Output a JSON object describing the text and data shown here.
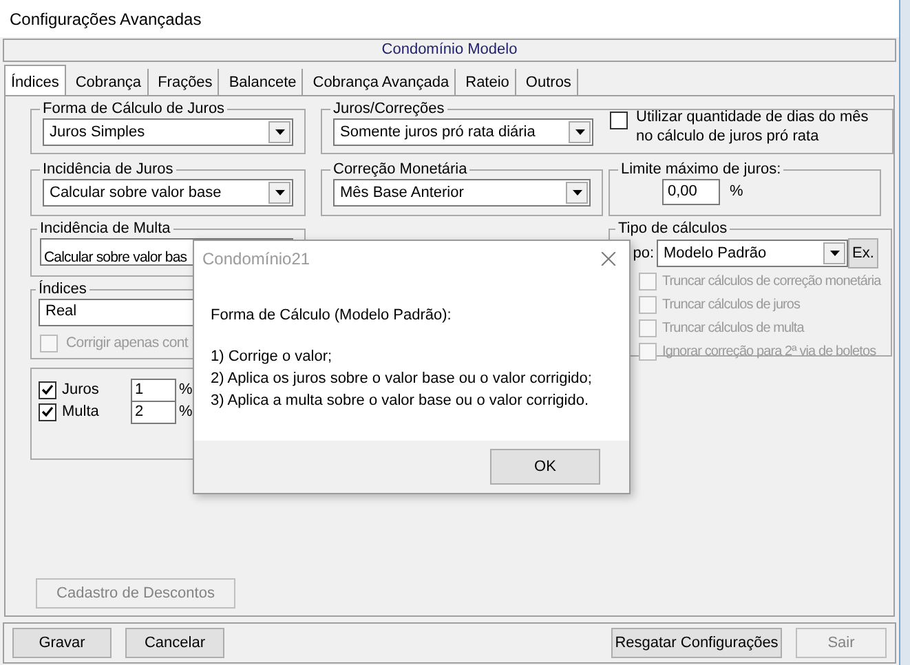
{
  "window": {
    "title": "Configurações Avançadas"
  },
  "header": "Condomínio Modelo",
  "tabs": [
    {
      "label": "Índices",
      "selected": true
    },
    {
      "label": "Cobrança",
      "selected": false
    },
    {
      "label": "Frações",
      "selected": false
    },
    {
      "label": "Balancete",
      "selected": false
    },
    {
      "label": "Cobrança Avançada",
      "selected": false
    },
    {
      "label": "Rateio",
      "selected": false
    },
    {
      "label": "Outros",
      "selected": false
    }
  ],
  "forma_calculo_juros": {
    "legend": "Forma de Cálculo de Juros",
    "value": "Juros Simples"
  },
  "juros_correcoes": {
    "legend": "Juros/Correções",
    "value": "Somente juros pró rata diária",
    "checkbox": {
      "label": "Utilizar quantidade de dias do mês no cálculo de juros pró rata",
      "checked": false
    }
  },
  "incidencia_juros": {
    "legend": "Incidência de Juros",
    "value": "Calcular sobre valor base"
  },
  "correcao_monetaria": {
    "legend": "Correção Monetária",
    "value": "Mês Base Anterior"
  },
  "limite_juros": {
    "legend": "Limite máximo de juros:",
    "value": "0,00",
    "unit": "%"
  },
  "incidencia_multa": {
    "legend": "Incidência de Multa",
    "value": "Calcular sobre valor bas"
  },
  "tipo_calculos": {
    "legend": "Tipo de cálculos",
    "label": "po:",
    "value": "Modelo Padrão",
    "button": "Ex.",
    "options": [
      {
        "label": "Truncar cálculos de correção monetária",
        "checked": false,
        "disabled": true
      },
      {
        "label": "Truncar cálculos de juros",
        "checked": false,
        "disabled": true
      },
      {
        "label": "Truncar cálculos de multa",
        "checked": false,
        "disabled": true
      },
      {
        "label": "Ignorar correção para 2ª via de boletos",
        "checked": false,
        "disabled": true
      }
    ]
  },
  "indices": {
    "legend": "Índices",
    "value": "Real",
    "checkbox": {
      "label": "Corrigir apenas cont",
      "checked": false,
      "disabled": true
    }
  },
  "rates": [
    {
      "label": "Juros",
      "checked": true,
      "value": "1",
      "unit": "%"
    },
    {
      "label": "Multa",
      "checked": true,
      "value": "2",
      "unit": "%"
    }
  ],
  "discount_button": {
    "label": "Cadastro de Descontos",
    "disabled": true
  },
  "footer_left_buttons": [
    {
      "label": "Gravar",
      "disabled": false
    },
    {
      "label": "Cancelar",
      "disabled": false
    }
  ],
  "footer_right_buttons": [
    {
      "label": "Resgatar Configurações",
      "disabled": false
    },
    {
      "label": "Sair",
      "disabled": true
    }
  ],
  "dialog": {
    "title": "Condomínio21",
    "heading": "Forma de Cálculo (Modelo Padrão):",
    "lines": [
      "1) Corrige o valor;",
      "2) Aplica os juros sobre o valor base ou o valor corrigido;",
      "3) Aplica a multa sobre o valor base ou o valor corrigido."
    ],
    "button": "OK"
  }
}
